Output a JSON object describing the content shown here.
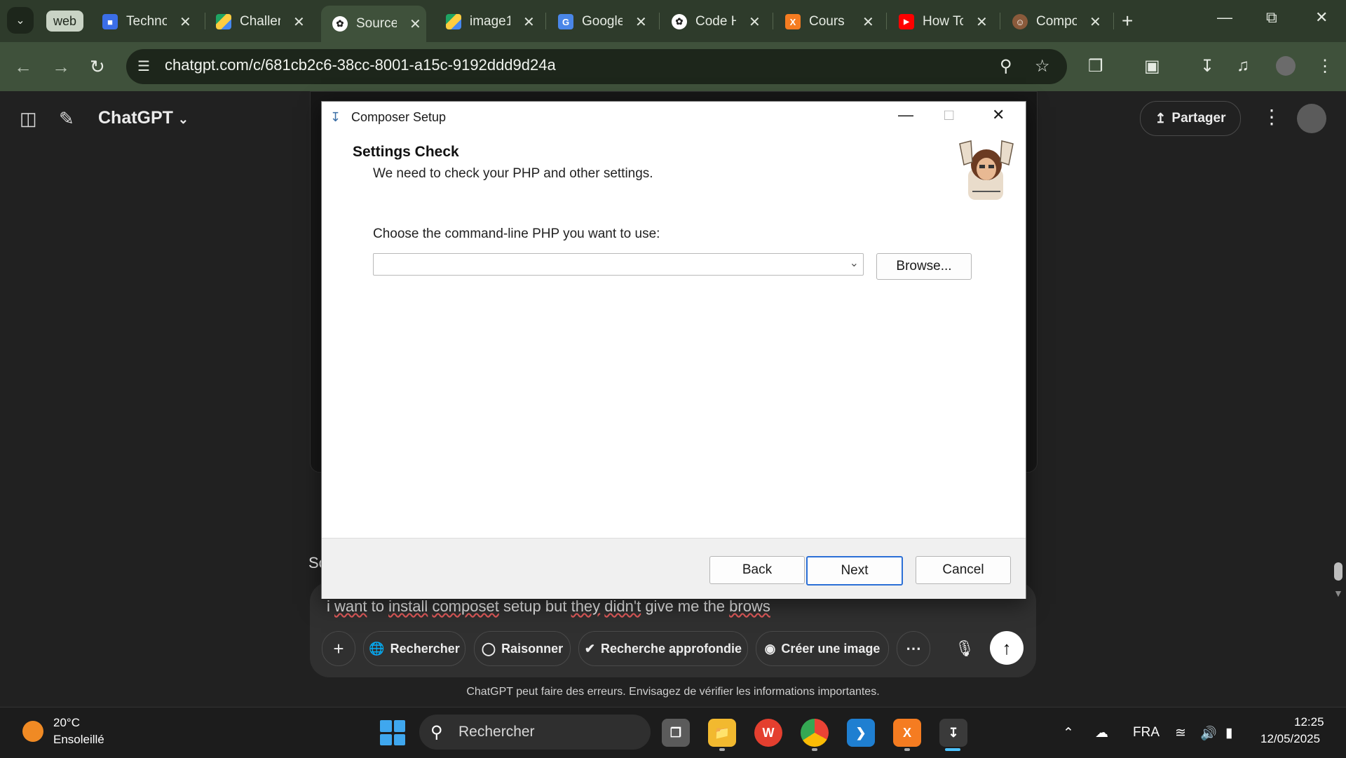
{
  "browser": {
    "tab_group_label": "web",
    "tabs": [
      {
        "label": "Techno",
        "icon": "classroom",
        "color": "#3b6ee8"
      },
      {
        "label": "Challer",
        "icon": "drive",
        "color": "#1fa463"
      },
      {
        "label": "Source",
        "icon": "chatgpt",
        "color": "#ffffff"
      },
      {
        "label": "image1",
        "icon": "drive",
        "color": "#1fa463"
      },
      {
        "label": "Google",
        "icon": "translate",
        "color": "#4a86e8"
      },
      {
        "label": "Code H",
        "icon": "chatgpt",
        "color": "#ffffff"
      },
      {
        "label": "Cours",
        "icon": "xampp",
        "color": "#f57c21"
      },
      {
        "label": "How To",
        "icon": "youtube",
        "color": "#ff0000"
      },
      {
        "label": "Compo",
        "icon": "composer",
        "color": "#8a5a3b"
      }
    ],
    "url": "chatgpt.com/c/681cb2c6-38cc-8001-a15c-9192ddd9d24a"
  },
  "chatgpt": {
    "title": "ChatGPT",
    "share_label": "Partager",
    "side_fragment": "So",
    "prompt_parts": [
      "i ",
      "want",
      " to ",
      "install",
      " ",
      "composet",
      " setup but ",
      "they",
      " ",
      "didn't",
      " give me the ",
      "brows"
    ],
    "tools": [
      {
        "label": "Rechercher",
        "icon": "globe"
      },
      {
        "label": "Raisonner",
        "icon": "lightbulb"
      },
      {
        "label": "Recherche approfondie",
        "icon": "telescope"
      },
      {
        "label": "Créer une image",
        "icon": "palette"
      }
    ],
    "disclaimer": "ChatGPT peut faire des erreurs. Envisagez de vérifier les informations importantes."
  },
  "dialog": {
    "title": "Composer Setup",
    "heading": "Settings Check",
    "subheading": "We need to check your PHP and other settings.",
    "label": "Choose the command-line PHP you want to use:",
    "php_value": "",
    "browse_label": "Browse...",
    "back_label": "Back",
    "next_label": "Next",
    "cancel_label": "Cancel"
  },
  "taskbar": {
    "temperature": "20°C",
    "weather": "Ensoleillé",
    "search_label": "Rechercher",
    "language": "FRA",
    "time": "12:25",
    "date": "12/05/2025"
  }
}
